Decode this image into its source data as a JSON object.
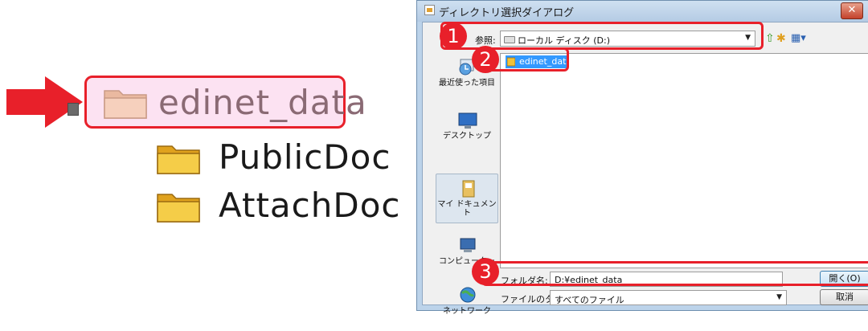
{
  "tree": {
    "root_label": "edinet_data",
    "children": [
      "PublicDoc",
      "AttachDoc"
    ],
    "colors": {
      "highlight_border": "#e8202a",
      "highlight_fill": "#fce2f2",
      "arrow": "#e8202a",
      "folder": "#f0c23a"
    }
  },
  "dialog": {
    "title": "ディレクトリ選択ダイアログ",
    "close_glyph": "✕",
    "lookin_label": "参照:",
    "lookin_value": "ローカル ディスク (D:)",
    "toolbar": {
      "up_icon": "up-folder-icon",
      "new_folder_icon": "new-folder-icon",
      "view_icon": "view-menu-icon"
    },
    "places": [
      {
        "label": "最近使った項目",
        "icon": "recent-items-icon"
      },
      {
        "label": "デスクトップ",
        "icon": "desktop-icon"
      },
      {
        "label": "マイ ドキュメント",
        "icon": "my-documents-icon",
        "selected": true
      },
      {
        "label": "コンピューター",
        "icon": "computer-icon"
      },
      {
        "label": "ネットワーク",
        "icon": "network-icon"
      }
    ],
    "files": [
      {
        "name": "edinet_data",
        "selected": true
      }
    ],
    "folder_name_label": "フォルダ名:",
    "folder_name_value": "D:¥edinet_data",
    "file_type_label": "ファイルのタイプ:",
    "file_type_value": "すべてのファイル",
    "open_button": "開く(O)",
    "cancel_button": "取消"
  },
  "callouts": [
    "1",
    "2",
    "3"
  ]
}
